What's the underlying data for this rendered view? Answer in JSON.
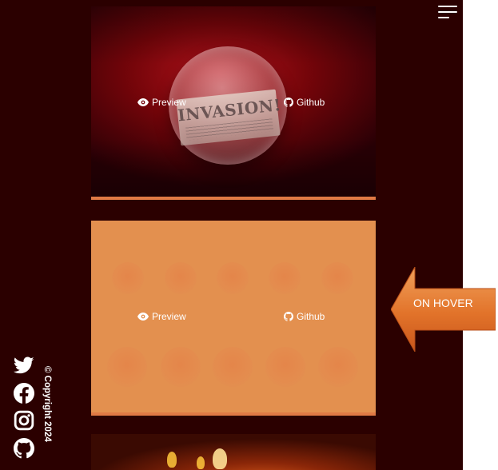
{
  "header": {
    "menu_icon": "hamburger-menu-icon"
  },
  "projects": [
    {
      "image_text": "INVASION!",
      "preview_label": "Preview",
      "github_label": "Github",
      "state": "default"
    },
    {
      "preview_label": "Preview",
      "github_label": "Github",
      "state": "hover"
    },
    {
      "state": "partially-visible"
    }
  ],
  "sidebar": {
    "social_icons": [
      "twitter-icon",
      "facebook-icon",
      "instagram-icon",
      "github-icon"
    ],
    "copyright": "© Copyright 2024"
  },
  "annotation": {
    "label": "ON HOVER"
  },
  "colors": {
    "background": "#2b0000",
    "accent": "#e07a45",
    "hover_card": "#e3904f",
    "text": "#ffffff"
  }
}
